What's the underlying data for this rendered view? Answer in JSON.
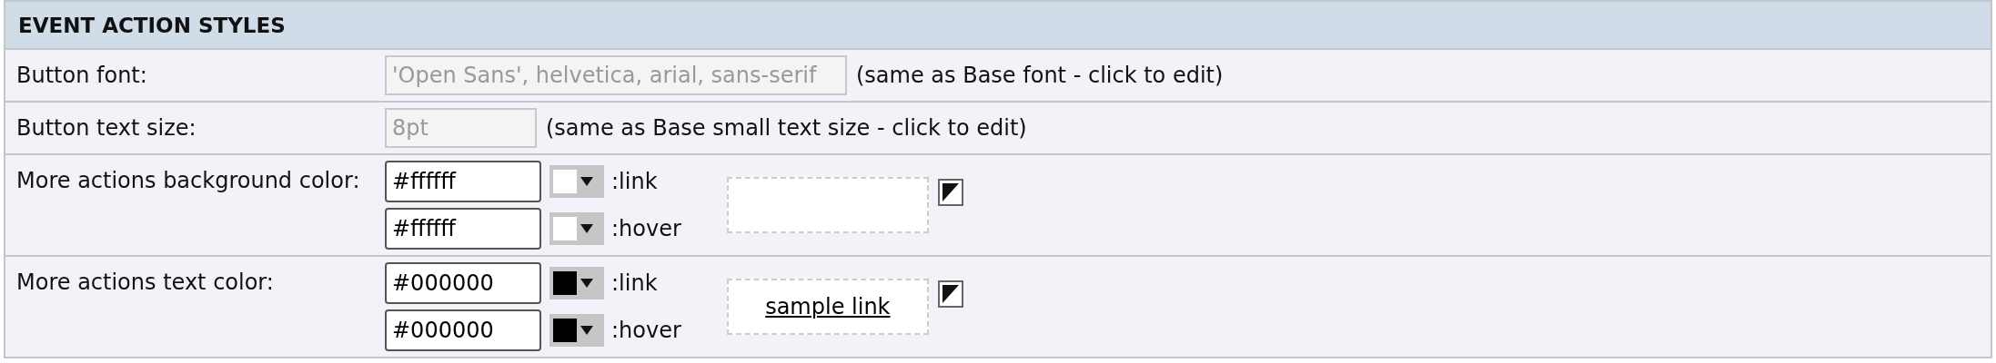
{
  "section": {
    "title": "EVENT ACTION STYLES"
  },
  "rows": [
    {
      "kind": "text",
      "label": "Button font:",
      "field": {
        "value": "'Open Sans', helvetica, arial, sans-serif",
        "disabled": true
      },
      "note": "(same as Base font - click to edit)"
    },
    {
      "kind": "text",
      "label": "Button text size:",
      "field": {
        "value": "8pt",
        "disabled": true
      },
      "note": "(same as Base small text size - click to edit)"
    },
    {
      "kind": "color",
      "label": "More actions background color:",
      "entries": [
        {
          "value": "#ffffff",
          "color": "#ffffff",
          "state": ":link"
        },
        {
          "value": "#ffffff",
          "color": "#ffffff",
          "state": ":hover"
        }
      ],
      "preview": {}
    },
    {
      "kind": "color",
      "label": "More actions text color:",
      "entries": [
        {
          "value": "#000000",
          "color": "#000000",
          "state": ":link"
        },
        {
          "value": "#000000",
          "color": "#000000",
          "state": ":hover"
        }
      ],
      "preview": {
        "text": "sample link"
      }
    }
  ]
}
